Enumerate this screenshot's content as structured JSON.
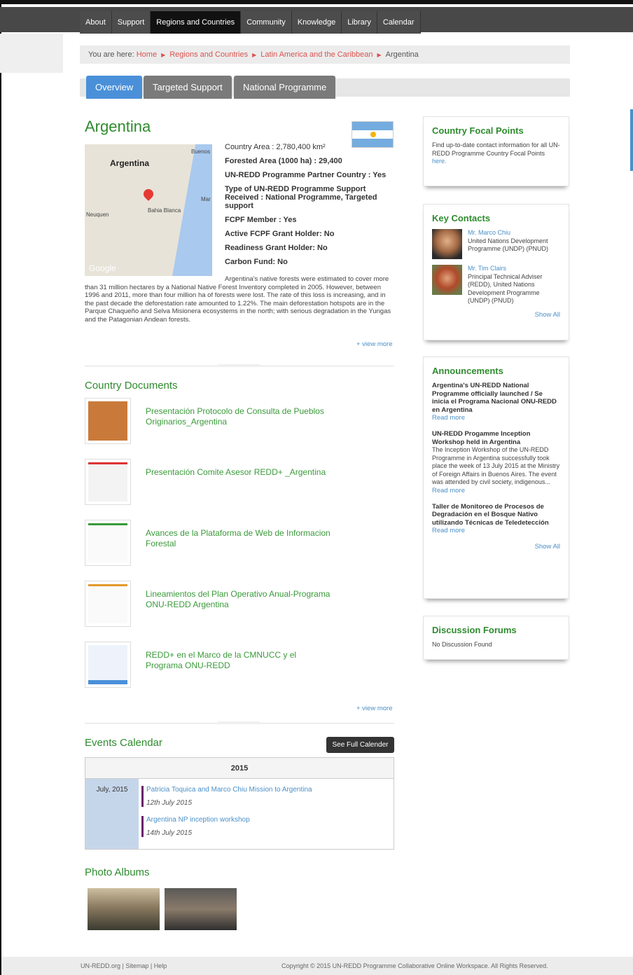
{
  "nav": [
    "About",
    "Support",
    "Regions and Countries",
    "Community",
    "Knowledge",
    "Library",
    "Calendar"
  ],
  "breadcrumb": {
    "prefix": "You are here:",
    "items": [
      "Home",
      "Regions and Countries",
      "Latin America and the Caribbean"
    ],
    "current": "Argentina"
  },
  "tabs": [
    "Overview",
    "Targeted Support",
    "National Programme"
  ],
  "country": {
    "name": "Argentina",
    "map_labels": {
      "country": "Argentina",
      "city1": "Bahia Blanca",
      "city2": "Buenos",
      "city3": "Mar",
      "city4": "Neuquen",
      "brand": "Google"
    },
    "facts": [
      "Country Area : 2,780,400 km²",
      "Forested Area (1000 ha) : 29,400",
      "UN-REDD Programme Partner Country : Yes",
      "Type of UN-REDD Programme Support Received : National Programme, Targeted support",
      "FCPF Member : Yes",
      "Active FCPF Grant Holder: No",
      "Readiness Grant Holder: No",
      "Carbon Fund: No"
    ],
    "description": "Argentina's native forests were estimated to cover more than 31 million hectares by a National Native Forest Inventory completed in 2005. However, between 1996 and 2011, more than four million ha of forests were lost. The rate of this loss is increasing, and in the past decade the deforestation rate amounted to 1.22%. The main deforestation hotspots are in the Parque Chaqueño and Selva Misionera ecosystems in the north; with serious degradation in the Yungas and the Patagonian Andean forests.",
    "view_more": "+ view more"
  },
  "documents": {
    "title": "Country Documents",
    "items": [
      "Presentación Protocolo de Consulta de Pueblos Originarios_Argentina",
      "Presentación Comite Asesor REDD+ _Argentina",
      "Avances de la Plataforma de Web de Informacion Forestal",
      "Lineamientos del Plan Operativo Anual-Programa ONU-REDD Argentina",
      "REDD+ en el Marco de la CMNUCC y el Programa ONU-REDD"
    ],
    "view_more": "+ view more"
  },
  "events": {
    "title": "Events Calendar",
    "button": "See Full Calender",
    "year": "2015",
    "month": "July, 2015",
    "items": [
      {
        "title": "Patricia Toquica and Marco Chiu Mission to Argentina",
        "date": "12th July 2015"
      },
      {
        "title": "Argentina NP inception workshop",
        "date": "14th July 2015"
      }
    ]
  },
  "photos": {
    "title": "Photo Albums"
  },
  "sidebar": {
    "focal": {
      "title": "Country Focal Points",
      "text": "Find up-to-date contact information for all UN-REDD Programme Country Focal Points",
      "link": "here."
    },
    "contacts": {
      "title": "Key Contacts",
      "items": [
        {
          "name": "Mr. Marco Chiu",
          "role": "United Nations Development Programme (UNDP) (PNUD)"
        },
        {
          "name": "Mr. Tim Clairs",
          "role": "Principal Technical Adviser (REDD), United Nations Development Programme (UNDP) (PNUD)"
        }
      ],
      "show_all": "Show All"
    },
    "announcements": {
      "title": "Announcements",
      "items": [
        {
          "title": "Argentina's UN-REDD National Programme officially launched / Se inicia el Programa Nacional ONU-REDD en Argentina",
          "body": "",
          "more": "Read more"
        },
        {
          "title": "UN-REDD Progamme Inception Workshop held in Argentina",
          "body": "The Inception Workshop of the UN-REDD Programme in Argentina successfully took place the week of 13 July 2015 at the Ministry of Foreign Affairs in Buenos Aires. The event was attended by civil society, indigenous...",
          "more": "Read more"
        },
        {
          "title": "Taller de Monitoreo de Procesos de Degradación en el Bosque Nativo utilizando Técnicas de Teledetección",
          "body": "",
          "more": "Read more"
        }
      ],
      "show_all": "Show All"
    },
    "forums": {
      "title": "Discussion Forums",
      "text": "No Discussion Found"
    }
  },
  "footer": {
    "left": "UN-REDD.org | Sitemap | Help",
    "right": "Copyright © 2015 UN-REDD Programme Collaborative Online Workspace. All Rights Reserved."
  }
}
